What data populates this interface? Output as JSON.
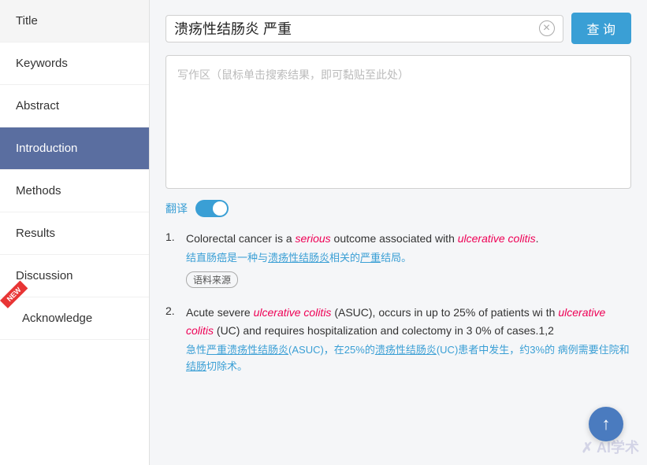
{
  "sidebar": {
    "items": [
      {
        "id": "title",
        "label": "Title",
        "active": false
      },
      {
        "id": "keywords",
        "label": "Keywords",
        "active": false
      },
      {
        "id": "abstract",
        "label": "Abstract",
        "active": false
      },
      {
        "id": "introduction",
        "label": "Introduction",
        "active": true
      },
      {
        "id": "methods",
        "label": "Methods",
        "active": false
      },
      {
        "id": "results",
        "label": "Results",
        "active": false
      },
      {
        "id": "discussion",
        "label": "Discussion",
        "active": false
      },
      {
        "id": "acknowledge",
        "label": "Acknowledge",
        "active": false,
        "badge": "NEW"
      }
    ]
  },
  "search": {
    "query": "溃疡性结肠炎 严重",
    "clear_title": "×",
    "button_label": "查 询"
  },
  "writing_area": {
    "placeholder": "写作区（鼠标单击搜索结果，即可黏贴至此处）"
  },
  "translate": {
    "label": "翻译",
    "enabled": true
  },
  "results": [
    {
      "number": "1.",
      "en_parts": [
        {
          "text": "Colorectal cancer is a ",
          "style": "normal"
        },
        {
          "text": "serious",
          "style": "italic-red"
        },
        {
          "text": " outcome associated with ",
          "style": "normal"
        },
        {
          "text": "ulcerative colitis",
          "style": "italic-red"
        },
        {
          "text": ".",
          "style": "normal"
        }
      ],
      "en_text": "Colorectal cancer is a serious outcome associated with ulcerative colitis.",
      "cn_text": "结直肠癌是一种与溃疡性结肠炎相关的严重结局。",
      "cn_highlights": [
        "溃疡性结肠炎",
        "严重"
      ],
      "source_tag": "语料来源"
    },
    {
      "number": "2.",
      "en_parts": [],
      "en_text": "Acute severe ulcerative colitis (ASUC), occurs in up to 25% of patients with ulcerative colitis (UC) and requires hospitalization and colectomy in 30% of cases.1,2",
      "cn_text": "急性严重溃疡性结肠炎(ASUC)，在25%的溃疡性结肠炎(UC)患者中发生，约3%的病例需要住院和结肠切除术。",
      "source_tag": null
    }
  ],
  "scroll_top": "↑",
  "watermark": "✗ AI学术"
}
